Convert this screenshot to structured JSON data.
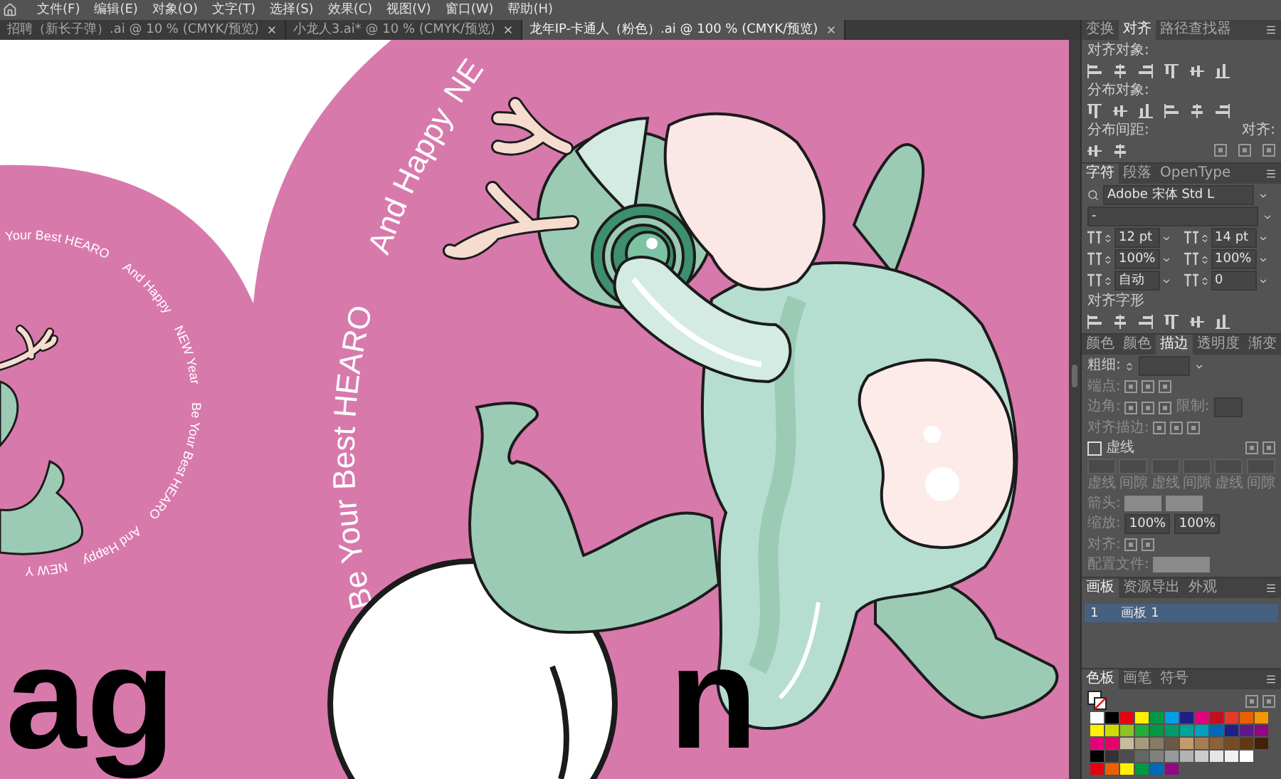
{
  "menu_bar": {
    "items": [
      "文件(F)",
      "编辑(E)",
      "对象(O)",
      "文字(T)",
      "选择(S)",
      "效果(C)",
      "视图(V)",
      "窗口(W)",
      "帮助(H)"
    ]
  },
  "document_tabs": [
    {
      "label": "招聘（新长子弹）.ai @ 10 % (CMYK/预览)",
      "selected": false
    },
    {
      "label": "小龙人3.ai* @ 10 % (CMYK/预览)",
      "selected": false
    },
    {
      "label": "龙年IP-卡通人（粉色）.ai @ 100 % (CMYK/预览)",
      "selected": true
    }
  ],
  "canvas": {
    "ring_text": [
      "Your Best HEARO",
      "And Happy",
      "NEW Year",
      "Be Your Best HEARO",
      "And Happy",
      "NEW Y"
    ],
    "arc_text": [
      "Be Your Best HEARO",
      "And Happy",
      "NE"
    ],
    "title_left": "ag",
    "title_right": "n"
  },
  "align_panel": {
    "tabs": [
      {
        "label": "变换",
        "selected": false
      },
      {
        "label": "对齐",
        "selected": true
      },
      {
        "label": "路径查找器",
        "selected": false
      }
    ],
    "align_objects_label": "对齐对象:",
    "distribute_objects_label": "分布对象:",
    "distribute_spacing_label": "分布间距:",
    "align_to_label": "对齐:"
  },
  "character_panel": {
    "tabs": [
      {
        "label": "字符",
        "selected": true
      },
      {
        "label": "段落",
        "selected": false
      },
      {
        "label": "OpenType",
        "selected": false
      }
    ],
    "font_family": "Adobe 宋体 Std L",
    "font_style": "-",
    "font_size": "12 pt",
    "leading": "14 pt",
    "vertical_scale": "100%",
    "horizontal_scale": "100%",
    "kerning": "自动",
    "tracking": "0",
    "align_glyphs_label": "对齐字形"
  },
  "stroke_panel": {
    "tabs": [
      {
        "label": "颜色",
        "selected": false
      },
      {
        "label": "颜色",
        "selected": false
      },
      {
        "label": "描边",
        "selected": true
      },
      {
        "label": "透明度",
        "selected": false
      },
      {
        "label": "渐变",
        "selected": false
      }
    ],
    "weight_label": "粗细:",
    "cap_label": "端点:",
    "corner_label": "边角:",
    "limit_label": "限制:",
    "align_stroke_label": "对齐描边:",
    "dashed_line": {
      "label": "虚线",
      "checked": false
    },
    "dash_labels": [
      "虚线",
      "间隙",
      "虚线",
      "间隙",
      "虚线",
      "间隙"
    ],
    "arrowheads_label": "箭头:",
    "scale_label": "缩放:",
    "scale_start": "100%",
    "scale_end": "100%",
    "align_label": "对齐:",
    "profile_label": "配置文件:"
  },
  "artboards_panel": {
    "tabs": [
      {
        "label": "画板",
        "selected": true
      },
      {
        "label": "资源导出",
        "selected": false
      },
      {
        "label": "外观",
        "selected": false
      }
    ],
    "rows": [
      {
        "number": "1",
        "name": "画板 1",
        "selected": true
      }
    ]
  },
  "swatches_panel": {
    "tabs": [
      {
        "label": "色板",
        "selected": true
      },
      {
        "label": "画笔",
        "selected": false
      },
      {
        "label": "符号",
        "selected": false
      }
    ]
  }
}
